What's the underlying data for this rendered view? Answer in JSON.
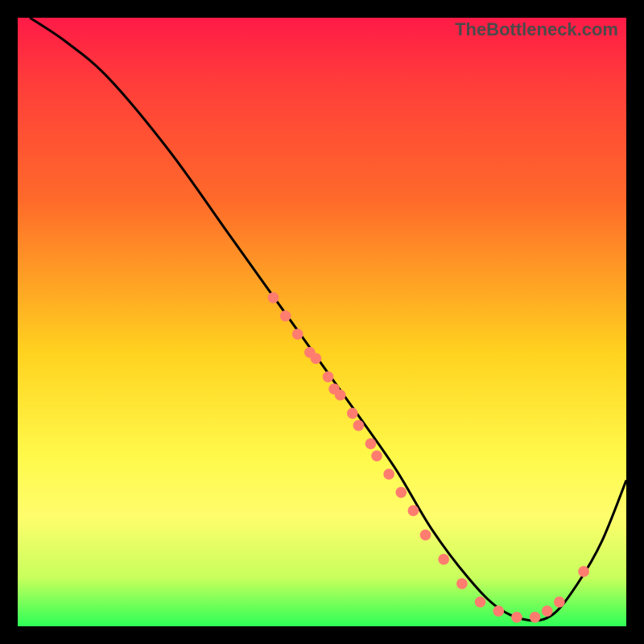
{
  "attribution": "TheBottleneck.com",
  "chart_data": {
    "type": "line",
    "title": "",
    "xlabel": "",
    "ylabel": "",
    "xlim": [
      0,
      100
    ],
    "ylim": [
      0,
      100
    ],
    "grid": false,
    "legend": false,
    "curve": {
      "name": "bottleneck-curve",
      "x": [
        2,
        8,
        15,
        25,
        35,
        45,
        55,
        62,
        68,
        74,
        79,
        84,
        88,
        92,
        96,
        100
      ],
      "y": [
        100,
        96,
        90,
        78,
        64,
        50,
        36,
        26,
        16,
        8,
        3,
        1,
        2,
        7,
        14,
        24
      ]
    },
    "highlight_points": {
      "name": "highlight-dots",
      "color": "#ff7d6f",
      "points": [
        {
          "x": 42,
          "y": 54
        },
        {
          "x": 44,
          "y": 51
        },
        {
          "x": 46,
          "y": 48
        },
        {
          "x": 48,
          "y": 45
        },
        {
          "x": 49,
          "y": 44
        },
        {
          "x": 51,
          "y": 41
        },
        {
          "x": 52,
          "y": 39
        },
        {
          "x": 53,
          "y": 38
        },
        {
          "x": 55,
          "y": 35
        },
        {
          "x": 56,
          "y": 33
        },
        {
          "x": 58,
          "y": 30
        },
        {
          "x": 59,
          "y": 28
        },
        {
          "x": 61,
          "y": 25
        },
        {
          "x": 63,
          "y": 22
        },
        {
          "x": 65,
          "y": 19
        },
        {
          "x": 67,
          "y": 15
        },
        {
          "x": 70,
          "y": 11
        },
        {
          "x": 73,
          "y": 7
        },
        {
          "x": 76,
          "y": 4
        },
        {
          "x": 79,
          "y": 2.5
        },
        {
          "x": 82,
          "y": 1.5
        },
        {
          "x": 85,
          "y": 1.5
        },
        {
          "x": 87,
          "y": 2.5
        },
        {
          "x": 89,
          "y": 4
        },
        {
          "x": 93,
          "y": 9
        }
      ]
    }
  }
}
